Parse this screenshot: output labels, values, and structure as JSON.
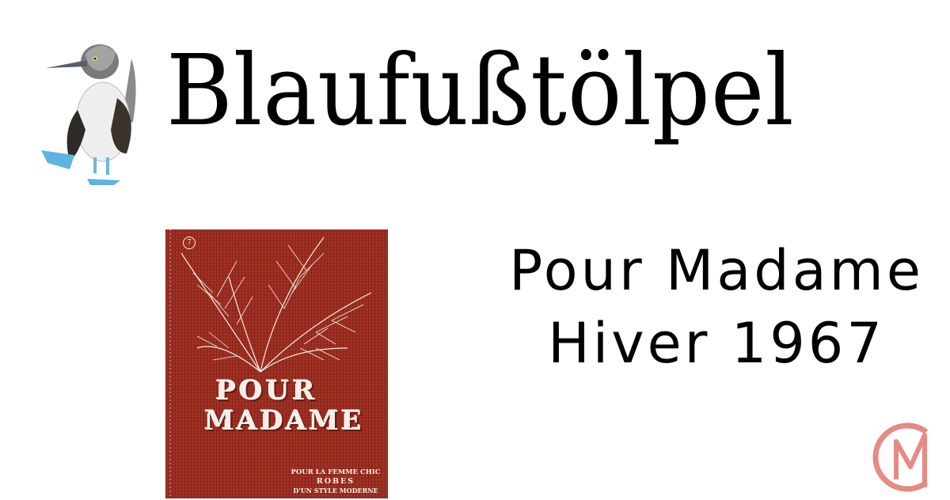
{
  "header": {
    "brand_title": "Blaufußtölpel",
    "logo_icon": "blue-footed-booby-icon"
  },
  "cover": {
    "issue_number": "7",
    "title_line1": "POUR",
    "title_line2": "MADAME",
    "subtitle_line1": "POUR LA FEMME CHIC",
    "subtitle_line2": "ROBES",
    "subtitle_line3": "D'UN STYLE MODERNE",
    "background_color": "#9a2d20"
  },
  "headline": {
    "line1": "Pour Madame",
    "line2": "Hiver 1967"
  },
  "corner_logo": {
    "icon": "cm-monogram-icon",
    "color": "#e58a84"
  }
}
